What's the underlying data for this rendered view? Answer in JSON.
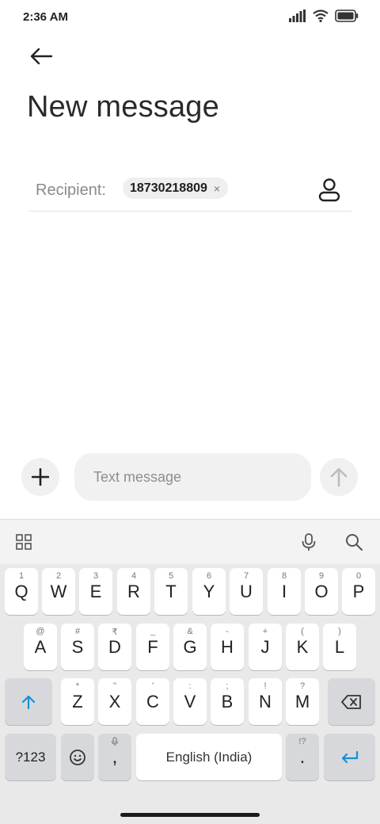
{
  "status": {
    "time": "2:36 AM"
  },
  "header": {
    "title": "New message"
  },
  "recipient": {
    "label": "Recipient:",
    "chip": "18730218809",
    "chip_close": "×"
  },
  "compose": {
    "placeholder": "Text message"
  },
  "keyboard": {
    "row1": [
      {
        "hint": "1",
        "key": "Q"
      },
      {
        "hint": "2",
        "key": "W"
      },
      {
        "hint": "3",
        "key": "E"
      },
      {
        "hint": "4",
        "key": "R"
      },
      {
        "hint": "5",
        "key": "T"
      },
      {
        "hint": "6",
        "key": "Y"
      },
      {
        "hint": "7",
        "key": "U"
      },
      {
        "hint": "8",
        "key": "I"
      },
      {
        "hint": "9",
        "key": "O"
      },
      {
        "hint": "0",
        "key": "P"
      }
    ],
    "row2": [
      {
        "hint": "@",
        "key": "A"
      },
      {
        "hint": "#",
        "key": "S"
      },
      {
        "hint": "₹",
        "key": "D"
      },
      {
        "hint": "_",
        "key": "F"
      },
      {
        "hint": "&",
        "key": "G"
      },
      {
        "hint": "-",
        "key": "H"
      },
      {
        "hint": "+",
        "key": "J"
      },
      {
        "hint": "(",
        "key": "K"
      },
      {
        "hint": ")",
        "key": "L"
      }
    ],
    "row3": [
      {
        "hint": "*",
        "key": "Z"
      },
      {
        "hint": "\"",
        "key": "X"
      },
      {
        "hint": "'",
        "key": "C"
      },
      {
        "hint": ":",
        "key": "V"
      },
      {
        "hint": ";",
        "key": "B"
      },
      {
        "hint": "!",
        "key": "N"
      },
      {
        "hint": "?",
        "key": "M"
      }
    ],
    "symbols_key": "?123",
    "comma_key": ",",
    "space_label": "English (India)",
    "period_key": ".",
    "period_hint": "!?"
  },
  "colors": {
    "accent": "#1a8fd6"
  }
}
